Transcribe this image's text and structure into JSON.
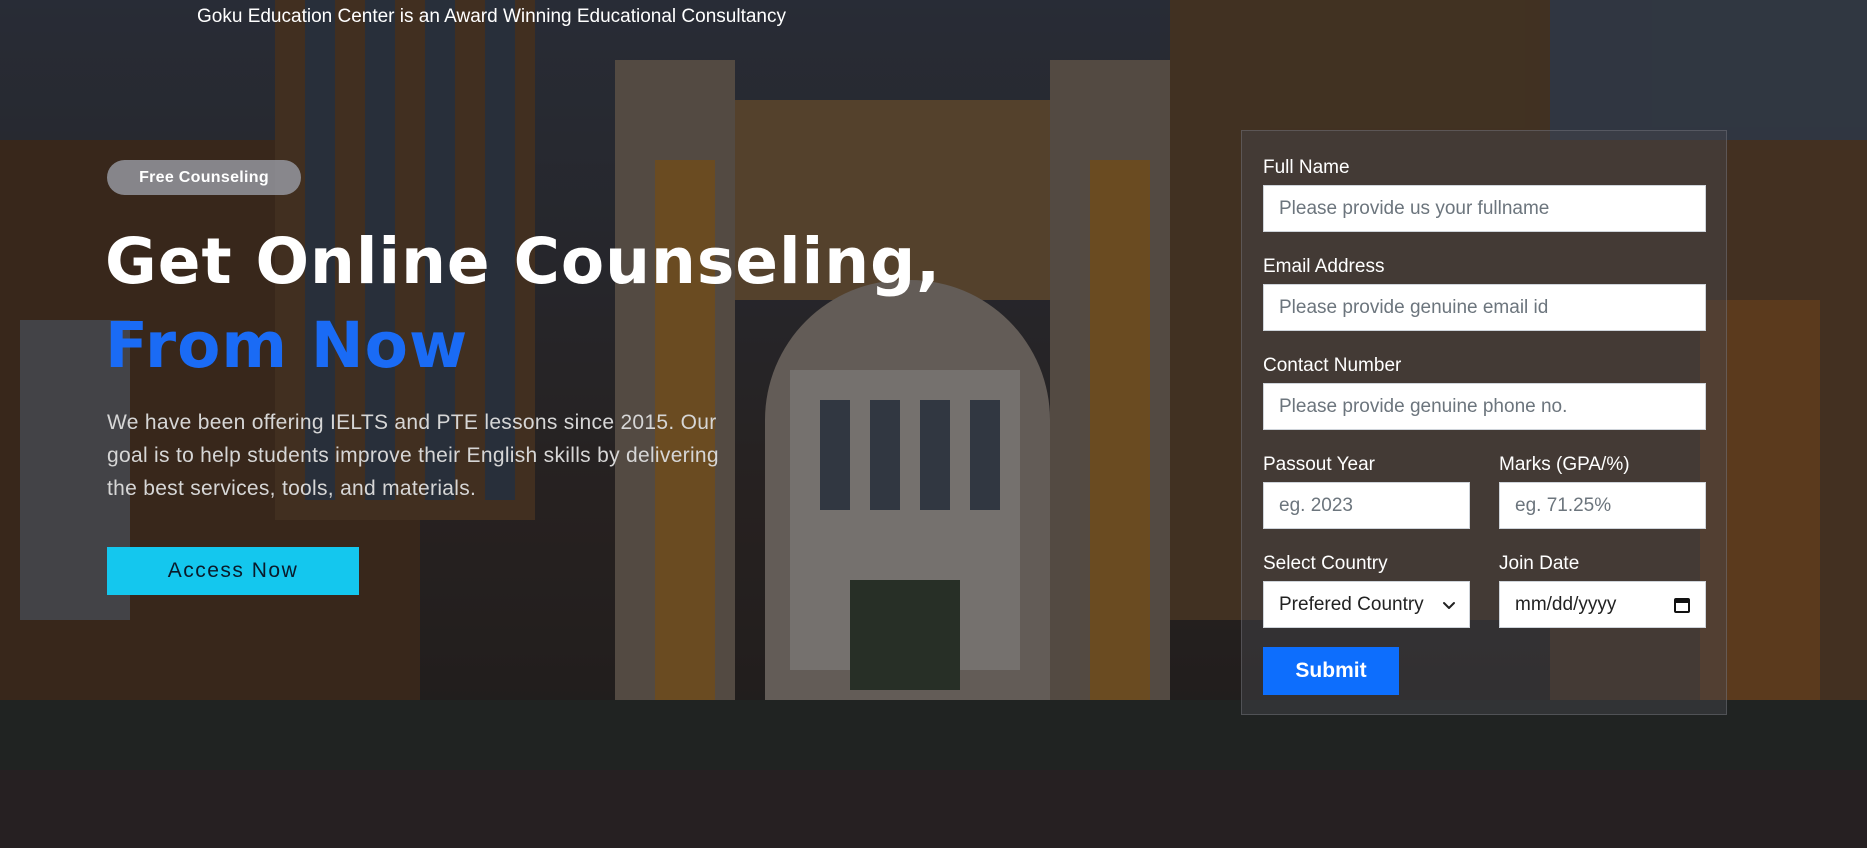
{
  "header": {
    "tagline": "Goku Education Center is an Award Winning Educational Consultancy"
  },
  "hero": {
    "badge": "Free Counseling",
    "headline_line1": "Get Online Counseling,",
    "headline_line2": "From Now",
    "description": "We have been offering IELTS and PTE lessons since 2015. Our goal is to help students improve their English skills by delivering the best services, tools, and materials.",
    "cta_label": "Access Now"
  },
  "form": {
    "full_name": {
      "label": "Full Name",
      "placeholder": "Please provide us your fullname"
    },
    "email": {
      "label": "Email Address",
      "placeholder": "Please provide genuine email id"
    },
    "contact": {
      "label": "Contact Number",
      "placeholder": "Please provide genuine phone no."
    },
    "passout_year": {
      "label": "Passout Year",
      "placeholder": "eg. 2023"
    },
    "marks": {
      "label": "Marks (GPA/%)",
      "placeholder": "eg. 71.25%"
    },
    "country": {
      "label": "Select Country",
      "selected": "Prefered Country"
    },
    "join_date": {
      "label": "Join Date",
      "value": "mm/dd/yyyy"
    },
    "submit_label": "Submit"
  },
  "colors": {
    "accent_blue": "#1a6bf5",
    "cta_cyan": "#14c7ee",
    "submit_blue": "#0d6efd"
  },
  "icons": {
    "select_arrow": "chevron-down-icon",
    "date_picker": "calendar-icon"
  }
}
